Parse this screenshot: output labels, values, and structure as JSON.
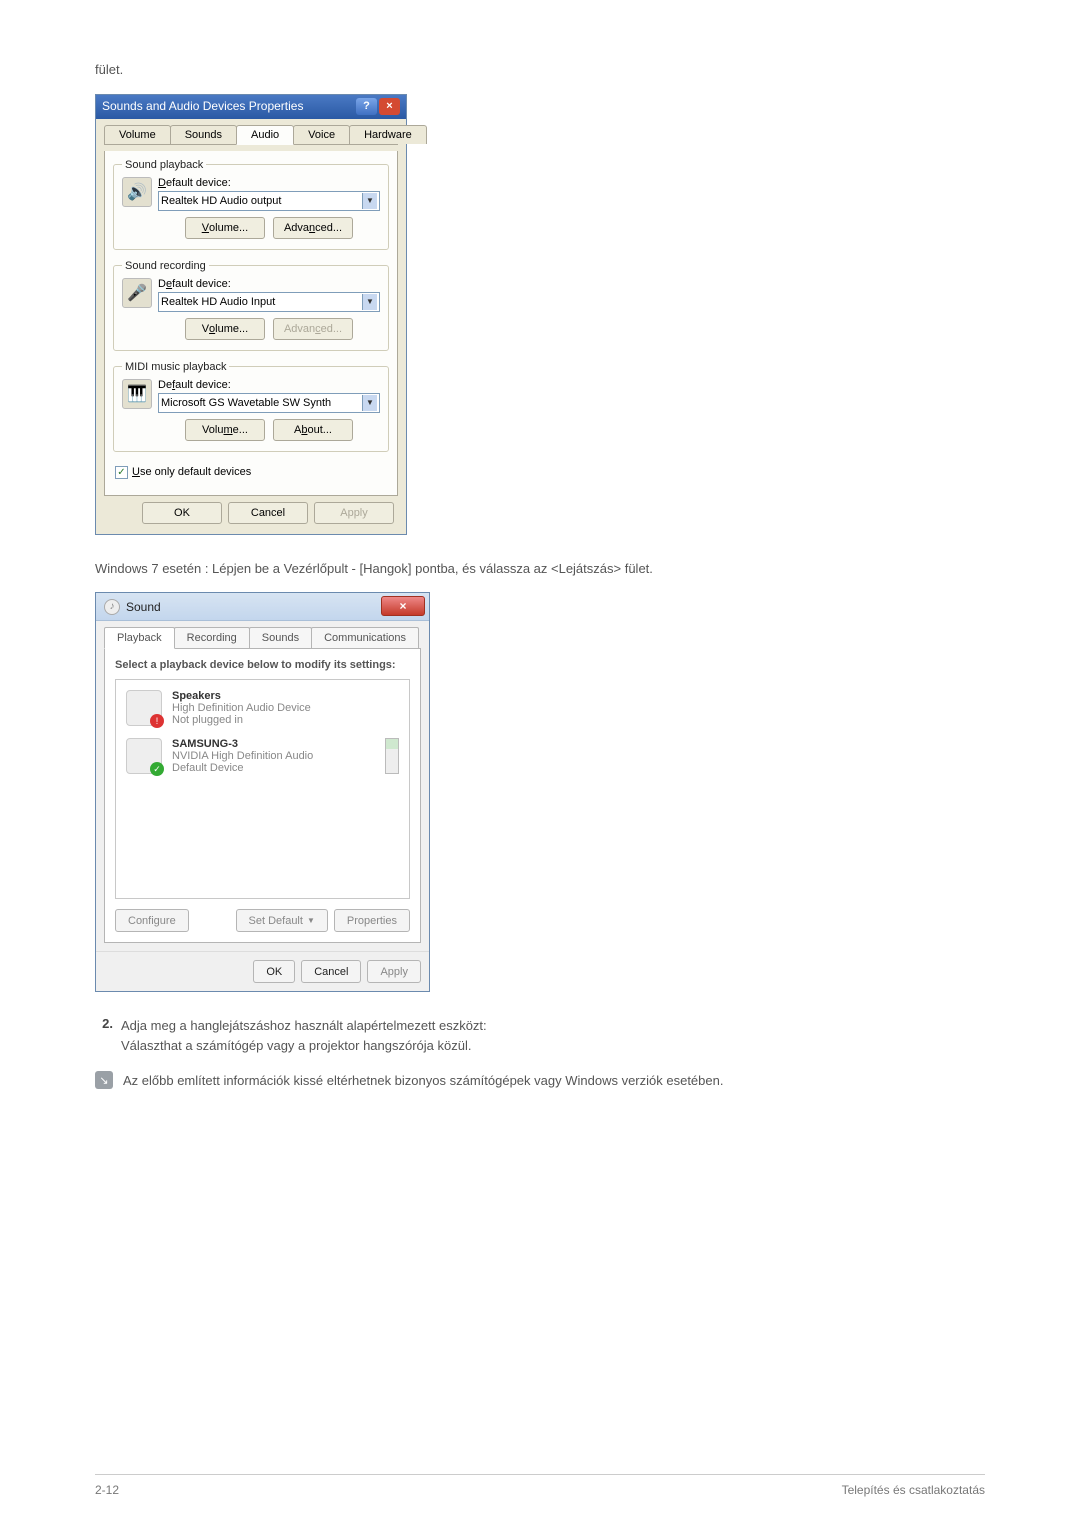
{
  "intro_text_top": "fület.",
  "xp": {
    "title": "Sounds and Audio Devices Properties",
    "tabs": [
      "Volume",
      "Sounds",
      "Audio",
      "Voice",
      "Hardware"
    ],
    "active_tab": 2,
    "groups": {
      "playback": {
        "legend": "Sound playback",
        "label": "Default device:",
        "device": "Realtek HD Audio output",
        "buttons": {
          "volume": "Volume...",
          "advanced": "Advanced..."
        },
        "advanced_disabled": false
      },
      "recording": {
        "legend": "Sound recording",
        "label": "Default device:",
        "device": "Realtek HD Audio Input",
        "buttons": {
          "volume": "Volume...",
          "advanced": "Advanced..."
        },
        "advanced_disabled": true
      },
      "midi": {
        "legend": "MIDI music playback",
        "label": "Default device:",
        "device": "Microsoft GS Wavetable SW Synth",
        "buttons": {
          "volume": "Volume...",
          "about": "About..."
        }
      }
    },
    "use_defaults": {
      "label": "Use only default devices",
      "checked": true
    },
    "actions": {
      "ok": "OK",
      "cancel": "Cancel",
      "apply": "Apply"
    }
  },
  "mid_text": "Windows 7 esetén : Lépjen be a Vezérlőpult - [Hangok] pontba, és válassza az <Lejátszás> fület.",
  "w7": {
    "title": "Sound",
    "tabs": [
      "Playback",
      "Recording",
      "Sounds",
      "Communications"
    ],
    "active_tab": 0,
    "instruction": "Select a playback device below to modify its settings:",
    "devices": [
      {
        "name": "Speakers",
        "sub": "High Definition Audio Device",
        "status": "Not plugged in",
        "badge": "err"
      },
      {
        "name": "SAMSUNG-3",
        "sub": "NVIDIA High Definition Audio",
        "status": "Default Device",
        "badge": "ok",
        "meter": true
      }
    ],
    "buttons": {
      "configure": "Configure",
      "setdefault": "Set Default",
      "properties": "Properties"
    },
    "actions": {
      "ok": "OK",
      "cancel": "Cancel",
      "apply": "Apply"
    }
  },
  "step": {
    "num": "2.",
    "line1": "Adja meg a hanglejátszáshoz használt alapértelmezett eszközt:",
    "line2": "Választhat a számítógép vagy a projektor hangszórója közül."
  },
  "note": "Az előbb említett információk kissé eltérhetnek bizonyos számítógépek vagy Windows verziók esetében.",
  "footer": {
    "left": "2-12",
    "right": "Telepítés és csatlakoztatás"
  }
}
